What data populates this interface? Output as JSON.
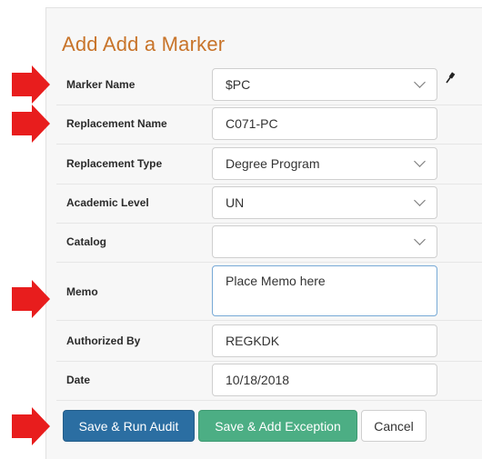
{
  "form": {
    "title": "Add Add a Marker",
    "fields": {
      "marker_name": {
        "label": "Marker Name",
        "value": "$PC"
      },
      "replacement_name": {
        "label": "Replacement Name",
        "value": "C071-PC"
      },
      "replacement_type": {
        "label": "Replacement Type",
        "value": "Degree Program"
      },
      "academic_level": {
        "label": "Academic Level",
        "value": "UN"
      },
      "catalog": {
        "label": "Catalog",
        "value": ""
      },
      "memo": {
        "label": "Memo",
        "value": "Place Memo here"
      },
      "authorized_by": {
        "label": "Authorized By",
        "value": "REGKDK"
      },
      "date": {
        "label": "Date",
        "value": "10/18/2018"
      }
    }
  },
  "buttons": {
    "save_run": "Save & Run Audit",
    "save_exception": "Save & Add Exception",
    "cancel": "Cancel"
  },
  "icons": {
    "pin": "pushpin-icon",
    "arrow": "red-pointer-arrow"
  },
  "colors": {
    "title": "#c8742a",
    "arrow": "#e81d1d",
    "primary": "#2b6ea2",
    "success": "#4cae84"
  }
}
